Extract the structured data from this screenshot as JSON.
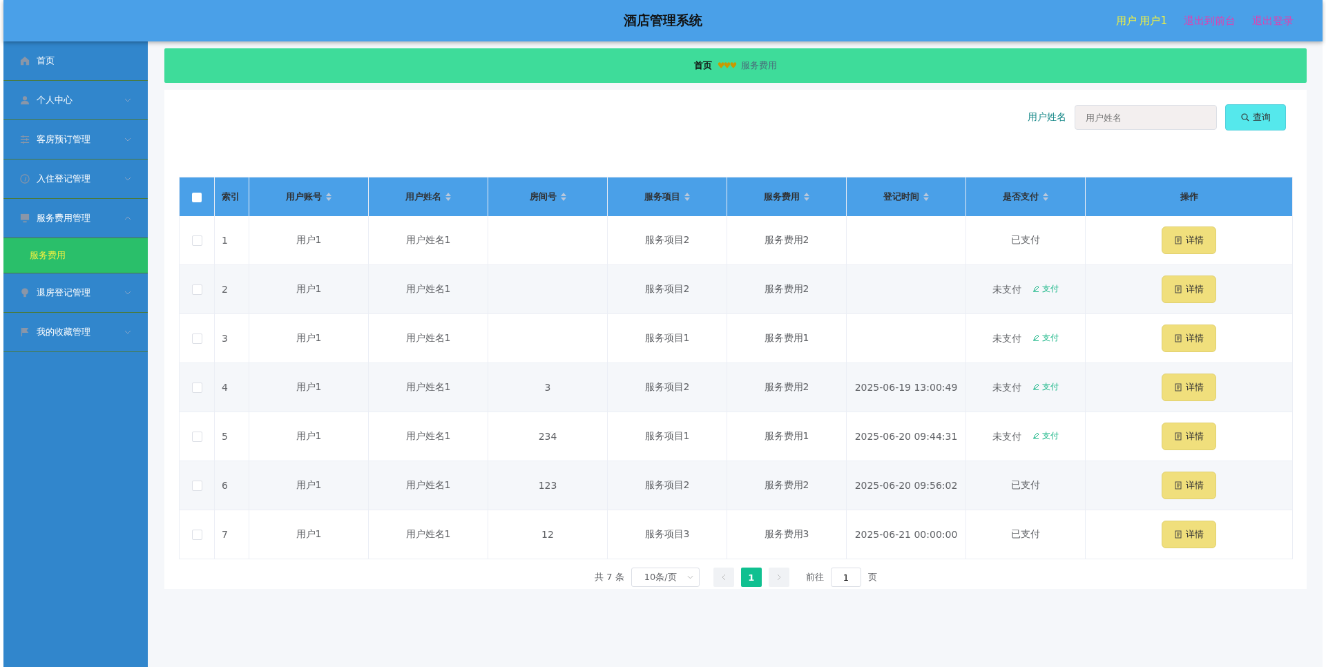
{
  "header": {
    "title": "酒店管理系统",
    "user": "用户 用户1",
    "links": [
      "退出到前台",
      "退出登录"
    ]
  },
  "sidebar": {
    "items": [
      {
        "label": "首页"
      },
      {
        "label": "个人中心",
        "expanded": false
      },
      {
        "label": "客房预订管理",
        "expanded": false
      },
      {
        "label": "入住登记管理",
        "expanded": false
      },
      {
        "label": "服务费用管理",
        "expanded": true,
        "children": [
          {
            "label": "服务费用",
            "selected": true
          }
        ]
      },
      {
        "label": "退房登记管理",
        "expanded": false
      },
      {
        "label": "我的收藏管理",
        "expanded": false
      }
    ]
  },
  "breadcrumb": {
    "items": [
      "首页",
      "服务费用"
    ],
    "separator": "♥♥♥"
  },
  "search": {
    "label": "用户姓名",
    "placeholder": "用户姓名",
    "button": "查询"
  },
  "table": {
    "all_checked": false,
    "columns": [
      {
        "label": "索引",
        "sortable": false
      },
      {
        "label": "用户账号",
        "sortable": true
      },
      {
        "label": "用户姓名",
        "sortable": true
      },
      {
        "label": "房间号",
        "sortable": true
      },
      {
        "label": "服务项目",
        "sortable": true
      },
      {
        "label": "服务费用",
        "sortable": true
      },
      {
        "label": "登记时间",
        "sortable": true
      },
      {
        "label": "是否支付",
        "sortable": true
      },
      {
        "label": "操作",
        "sortable": false
      }
    ],
    "rows": [
      {
        "index": "1",
        "account": "用户1",
        "name": "用户姓名1",
        "room": "",
        "item": "服务项目2",
        "fee": "服务费用2",
        "time": "",
        "status": "已支付",
        "paid": true,
        "checked": false,
        "action": "详情"
      },
      {
        "index": "2",
        "account": "用户1",
        "name": "用户姓名1",
        "room": "",
        "item": "服务项目2",
        "fee": "服务费用2",
        "time": "",
        "status": "未支付",
        "paid": false,
        "pay_link": "支付",
        "checked": false,
        "action": "详情"
      },
      {
        "index": "3",
        "account": "用户1",
        "name": "用户姓名1",
        "room": "",
        "item": "服务项目1",
        "fee": "服务费用1",
        "time": "",
        "status": "未支付",
        "paid": false,
        "pay_link": "支付",
        "checked": false,
        "action": "详情"
      },
      {
        "index": "4",
        "account": "用户1",
        "name": "用户姓名1",
        "room": "3",
        "item": "服务项目2",
        "fee": "服务费用2",
        "time": "2025-06-19 13:00:49",
        "status": "未支付",
        "paid": false,
        "pay_link": "支付",
        "checked": false,
        "action": "详情"
      },
      {
        "index": "5",
        "account": "用户1",
        "name": "用户姓名1",
        "room": "234",
        "item": "服务项目1",
        "fee": "服务费用1",
        "time": "2025-06-20 09:44:31",
        "status": "未支付",
        "paid": false,
        "pay_link": "支付",
        "checked": false,
        "action": "详情"
      },
      {
        "index": "6",
        "account": "用户1",
        "name": "用户姓名1",
        "room": "123",
        "item": "服务项目2",
        "fee": "服务费用2",
        "time": "2025-06-20 09:56:02",
        "status": "已支付",
        "paid": true,
        "checked": false,
        "action": "详情"
      },
      {
        "index": "7",
        "account": "用户1",
        "name": "用户姓名1",
        "room": "12",
        "item": "服务项目3",
        "fee": "服务费用3",
        "time": "2025-06-21 00:00:00",
        "status": "已支付",
        "paid": true,
        "checked": false,
        "action": "详情"
      }
    ]
  },
  "pagination": {
    "total": "共 7 条",
    "page_size": "10条/页",
    "pages": [
      {
        "label": "1",
        "selected": true
      }
    ],
    "goto_label": "前往",
    "goto_value": "1",
    "goto_suffix": "页"
  }
}
